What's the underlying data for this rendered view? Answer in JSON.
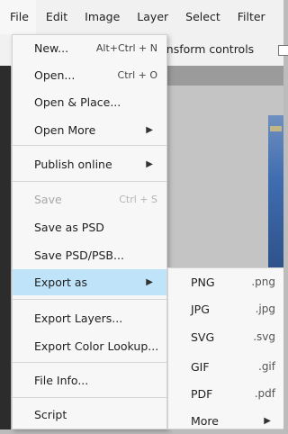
{
  "menubar": {
    "items": [
      "File",
      "Edit",
      "Image",
      "Layer",
      "Select",
      "Filter"
    ]
  },
  "options_bar": {
    "text": "ransform controls"
  },
  "file_menu": {
    "items": [
      {
        "label": "New...",
        "shortcut": "Alt+Ctrl + N"
      },
      {
        "label": "Open...",
        "shortcut": "Ctrl + O"
      },
      {
        "label": "Open & Place..."
      },
      {
        "label": "Open More",
        "submenu": true
      },
      {
        "label": "Publish online",
        "submenu": true
      },
      {
        "label": "Save",
        "shortcut": "Ctrl + S",
        "disabled": true
      },
      {
        "label": "Save as PSD"
      },
      {
        "label": "Save PSD/PSB..."
      },
      {
        "label": "Export as",
        "submenu": true,
        "highlighted": true
      },
      {
        "label": "Export Layers..."
      },
      {
        "label": "Export Color Lookup..."
      },
      {
        "label": "File Info..."
      },
      {
        "label": "Script"
      }
    ],
    "arrow_glyph": "▶"
  },
  "export_submenu": {
    "items": [
      {
        "label": "PNG",
        "ext": ".png"
      },
      {
        "label": "JPG",
        "ext": ".jpg"
      },
      {
        "label": "SVG",
        "ext": ".svg"
      },
      {
        "label": "GIF",
        "ext": ".gif"
      },
      {
        "label": "PDF",
        "ext": ".pdf"
      },
      {
        "label": "More",
        "submenu": true
      }
    ]
  },
  "colors": {
    "highlight": "#bfe4fa",
    "menu_bg": "#f7f7f7",
    "disabled_text": "#a8a8a8"
  }
}
